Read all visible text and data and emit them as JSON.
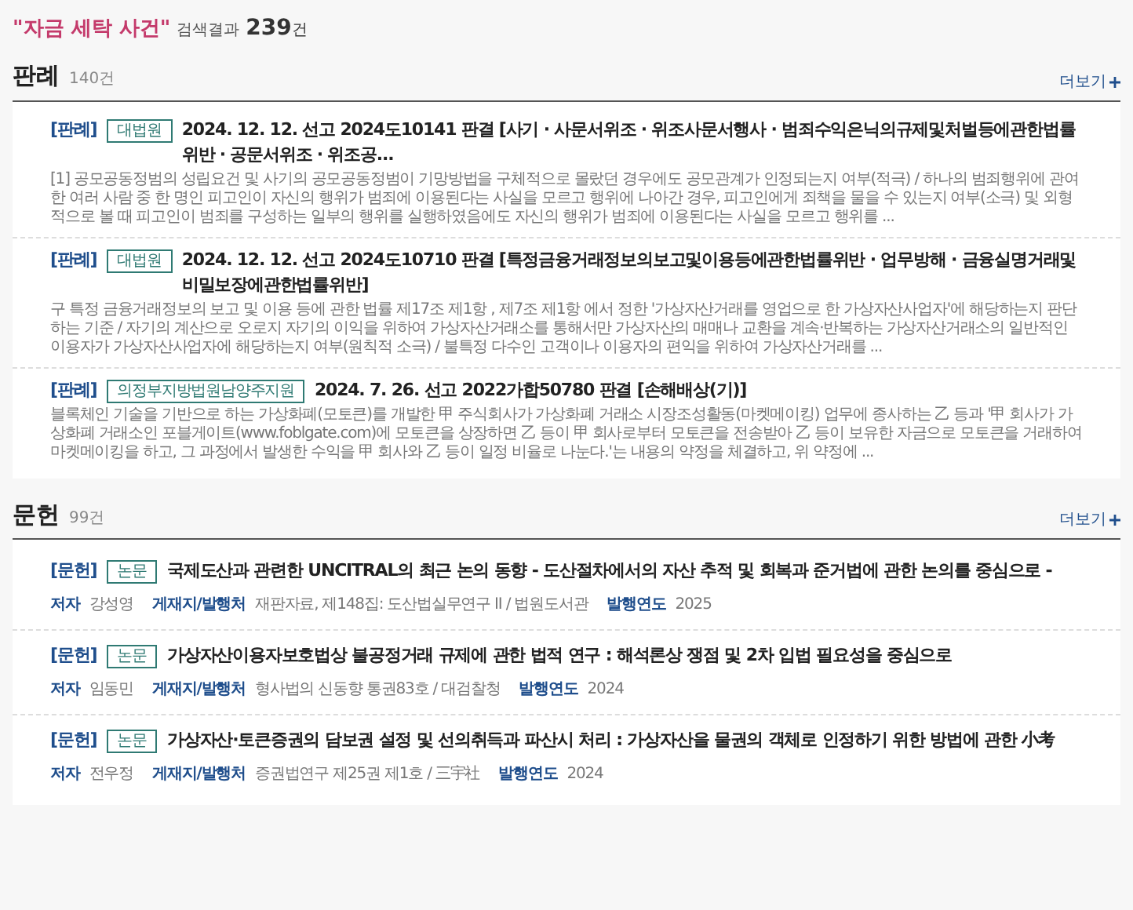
{
  "search": {
    "query": "\"자금 세탁 사건\"",
    "label": "검색결과",
    "count": "239",
    "unit": "건"
  },
  "sections": [
    {
      "title": "판례",
      "count": "140건",
      "more": "더보기",
      "items": [
        {
          "kind": "case",
          "category": "[판례]",
          "badge": "대법원",
          "title": "2024. 12. 12. 선고 2024도10141 판결 [사기 · 사문서위조 · 위조사문서행사 · 범죄수익은닉의규제및처벌등에관한법률위반 · 공문서위조 · 위조공...",
          "snippet": "[1] 공모공동정범의 성립요건 및 사기의 공모공동정범이 기망방법을 구체적으로 몰랐던 경우에도 공모관계가 인정되는지 여부(적극) / 하나의 범죄행위에 관여한 여러 사람 중 한 명인 피고인이 자신의 행위가 범죄에 이용된다는 사실을 모르고 행위에 나아간 경우, 피고인에게 죄책을 물을 수 있는지 여부(소극) 및 외형적으로 볼 때 피고인이 범죄를 구성하는 일부의 행위를 실행하였음에도 자신의 행위가 범죄에 이용된다는 사실을 모르고 행위를 ..."
        },
        {
          "kind": "case",
          "category": "[판례]",
          "badge": "대법원",
          "title": "2024. 12. 12. 선고 2024도10710 판결 [특정금융거래정보의보고및이용등에관한법률위반 · 업무방해 · 금융실명거래및비밀보장에관한법률위반]",
          "snippet": "구 특정 금융거래정보의 보고 및 이용 등에 관한 법률 제17조 제1항 , 제7조 제1항 에서 정한 '가상자산거래를 영업으로 한 가상자산사업자'에 해당하는지 판단하는 기준 / 자기의 계산으로 오로지 자기의 이익을 위하여 가상자산거래소를 통해서만 가상자산의 매매나 교환을 계속·반복하는 가상자산거래소의 일반적인 이용자가 가상자산사업자에 해당하는지 여부(원칙적 소극) / 불특정 다수인 고객이나 이용자의 편익을 위하여 가상자산거래를 ..."
        },
        {
          "kind": "case",
          "category": "[판례]",
          "badge": "의정부지방법원남양주지원",
          "title": "2024. 7. 26. 선고 2022가합50780 판결 [손해배상(기)]",
          "snippet": "블록체인 기술을 기반으로 하는 가상화폐(모토큰)를 개발한 甲 주식회사가 가상화폐 거래소 시장조성활동(마켓메이킹) 업무에 종사하는 乙 등과 '甲 회사가 가상화폐 거래소인 포블게이트(www.foblgate.com)에 모토큰을 상장하면 乙 등이 甲 회사로부터 모토큰을 전송받아 乙 등이 보유한 자금으로 모토큰을 거래하여 마켓메이킹을 하고, 그 과정에서 발생한 수익을 甲 회사와 乙 등이 일정 비율로 나눈다.'는 내용의 약정을 체결하고, 위 약정에 ..."
        }
      ]
    },
    {
      "title": "문헌",
      "count": "99건",
      "more": "더보기",
      "items": [
        {
          "kind": "paper",
          "category": "[문헌]",
          "badge": "논문",
          "title": "국제도산과 관련한 UNCITRAL의 최근 논의 동향 - 도산절차에서의 자산 추적 및 회복과 준거법에 관한 논의를 중심으로 -",
          "meta": [
            {
              "label": "저자",
              "value": "강성영"
            },
            {
              "label": "게재지/발행처",
              "value": "재판자료, 제148집: 도산법실무연구 II / 법원도서관"
            },
            {
              "label": "발행연도",
              "value": "2025"
            }
          ]
        },
        {
          "kind": "paper",
          "category": "[문헌]",
          "badge": "논문",
          "title": "가상자산이용자보호법상 불공정거래 규제에 관한 법적 연구 : 해석론상 쟁점 및 2차 입법 필요성을 중심으로",
          "meta": [
            {
              "label": "저자",
              "value": "임동민"
            },
            {
              "label": "게재지/발행처",
              "value": "형사법의 신동향 통권83호 / 대검찰청"
            },
            {
              "label": "발행연도",
              "value": "2024"
            }
          ]
        },
        {
          "kind": "paper",
          "category": "[문헌]",
          "badge": "논문",
          "title": "가상자산·토큰증권의 담보권 설정 및 선의취득과 파산시 처리 : 가상자산을 물권의 객체로 인정하기 위한 방법에 관한 小考",
          "meta": [
            {
              "label": "저자",
              "value": "전우정"
            },
            {
              "label": "게재지/발행처",
              "value": "증권법연구 제25권 제1호 / 三宇社"
            },
            {
              "label": "발행연도",
              "value": "2024"
            }
          ]
        }
      ]
    }
  ]
}
